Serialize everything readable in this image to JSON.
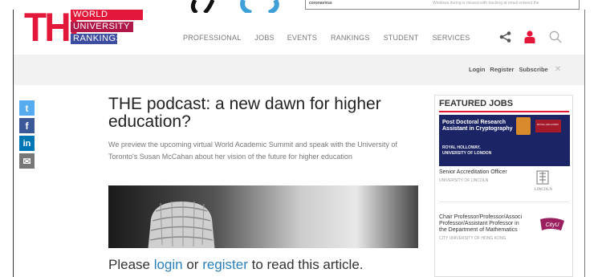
{
  "background": {
    "fragment_left": "coronavirus",
    "fragment_right": "Windows during is missed with tracking at email entered the"
  },
  "brand": {
    "the": "THE",
    "line1": "WORLD",
    "line2": "UNIVERSITY",
    "line3": "RANKINGS",
    "red": "#e2173a",
    "plum": "#b0184a",
    "blue": "#3d4ea0"
  },
  "nav": {
    "items": [
      "PROFESSIONAL",
      "JOBS",
      "EVENTS",
      "RANKINGS",
      "STUDENT",
      "SERVICES"
    ]
  },
  "header_icons": [
    "share-icon",
    "user-icon",
    "search-icon"
  ],
  "account": {
    "login": "Login",
    "register": "Register",
    "subscribe": "Subscribe",
    "close": "✕"
  },
  "social": {
    "twitter": "t",
    "facebook": "f",
    "linkedin": "in",
    "email": "✉",
    "colors": {
      "twitter": "#55acee",
      "facebook": "#3b5998",
      "linkedin": "#0077b5",
      "email": "#777777"
    }
  },
  "article": {
    "title": "THE podcast: a new dawn for higher education?",
    "summary": "We preview the upcoming virtual World Academic Summit and speak with the University of Toronto's Susan McCahan about her vision of the future for higher education",
    "hero_icon": "microphone-icon",
    "login_prompt_pre": "Please ",
    "login_link": "login",
    "login_prompt_mid": " or ",
    "register_link": "register",
    "login_prompt_post": " to read this article."
  },
  "featured_jobs": {
    "heading": "FEATURED JOBS",
    "banner": {
      "title": "Post Doctoral Research Assistant in Cryptography",
      "org_line1": "ROYAL HOLLOWAY,",
      "org_line2": "UNIVERSITY OF LONDON",
      "badge": "ROYAL HOLLOWAY"
    },
    "jobs": [
      {
        "title": "Senior Accreditation Officer",
        "org": "UNIVERSITY OF LINCOLN",
        "logo": "LINCOLN"
      },
      {
        "title": "Chair Professor/Professor/Associ Professor/Assistant Professor in the Department of Mathematics",
        "org": "CITY UNIVERSITY OF HONG KONG",
        "logo": "CityU"
      }
    ]
  }
}
